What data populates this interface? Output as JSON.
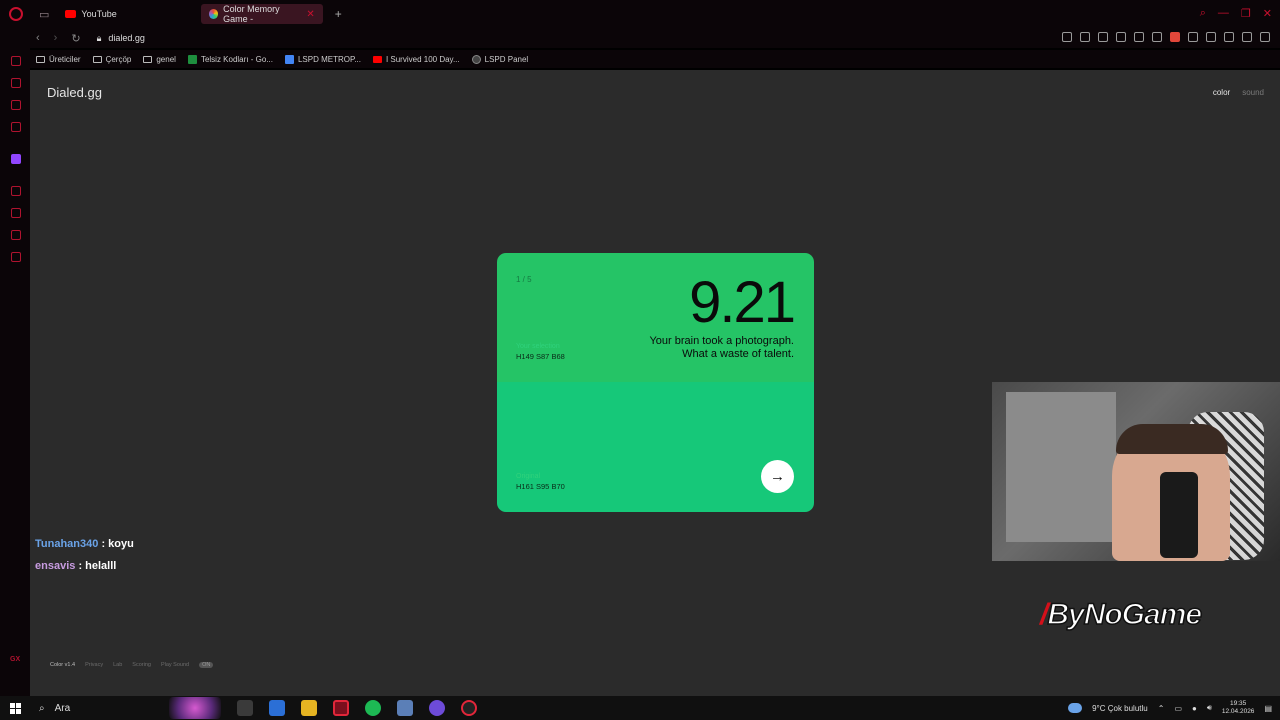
{
  "browser": {
    "tabs": [
      {
        "label": "YouTube"
      },
      {
        "label": "Color Memory Game -"
      }
    ],
    "url": "dialed.gg",
    "bookmarks": [
      {
        "label": "Üreticiler"
      },
      {
        "label": "Çerçöp"
      },
      {
        "label": "genel"
      },
      {
        "label": "Telsiz Kodları - Go..."
      },
      {
        "label": "LSPD METROP..."
      },
      {
        "label": "I Survived 100 Day..."
      },
      {
        "label": "LSPD Panel"
      }
    ]
  },
  "page": {
    "brand": "Dialed.gg",
    "modes": {
      "color": "color",
      "sound": "sound"
    },
    "card": {
      "round": "1 / 5",
      "score": "9.21",
      "message_line1": "Your brain took a photograph.",
      "message_line2": "What a waste of talent.",
      "selection_label": "Your selection",
      "selection_value": "H149 S87 B68",
      "original_label": "Original",
      "original_value": "H161 S95 B70",
      "next_arrow": "→",
      "colors": {
        "selection": "#25c466",
        "original": "#16c879"
      }
    },
    "footer": {
      "version": "Color v1.4",
      "links": [
        "Privacy",
        "Lab",
        "Scoring",
        "Play Sound"
      ],
      "pill": "ON"
    }
  },
  "chat": [
    {
      "user": "Tunahan340",
      "message": ": koyu"
    },
    {
      "user": "ensavis",
      "message": ": helalll"
    }
  ],
  "overlay": {
    "watermark_prefix": "/",
    "watermark_text": "ByNoGame"
  },
  "taskbar": {
    "search_placeholder": "Ara",
    "weather": "9°C  Çok bulutlu",
    "time": "19:35",
    "date": "12.04.2026"
  }
}
